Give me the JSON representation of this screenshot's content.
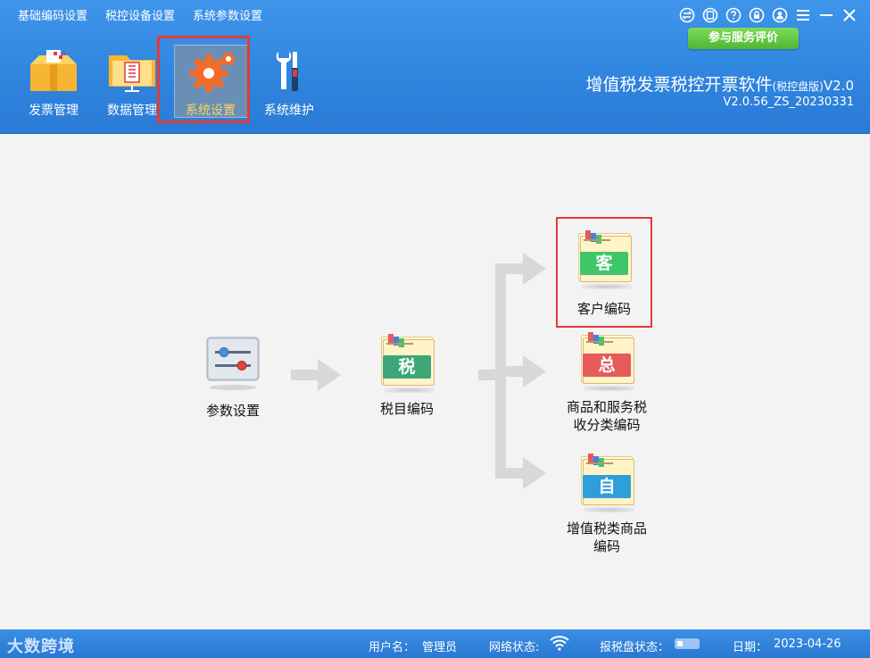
{
  "menu": [
    "基础编码设置",
    "税控设备设置",
    "系统参数设置"
  ],
  "eval_button": "参与服务评价",
  "nav": [
    {
      "label": "发票管理",
      "icon": "invoice-box-icon"
    },
    {
      "label": "数据管理",
      "icon": "data-folder-icon"
    },
    {
      "label": "系统设置",
      "icon": "gear-settings-icon",
      "active": true
    },
    {
      "label": "系统维护",
      "icon": "tools-icon"
    }
  ],
  "app": {
    "title_main": "增值税发票税控开票软件",
    "title_small": "(税控盘版)",
    "title_ver": "V2.0",
    "version": "V2.0.56_ZS_20230331"
  },
  "flow": {
    "params": "参数设置",
    "tax_code": "税目编码",
    "tax_char": "税",
    "customer": "客户编码",
    "customer_char": "客",
    "goods_line1": "商品和服务税",
    "goods_line2": "收分类编码",
    "goods_char": "总",
    "vat_line1": "增值税类商品",
    "vat_line2": "编码",
    "vat_char": "自"
  },
  "status": {
    "brand": "大数跨境",
    "user_label": "用户名：",
    "user_value": "管理员",
    "net_label": "网络状态:",
    "disk_label": "报税盘状态：",
    "date_label": "日期：",
    "date_value": "2023-04-26"
  },
  "colors": {
    "header": "#2f84de",
    "tax_band": "#3ea77a",
    "customer_band": "#3fc66a",
    "goods_band": "#e55b5b",
    "vat_band": "#2f9fd9",
    "highlight": "#e23a3a"
  }
}
